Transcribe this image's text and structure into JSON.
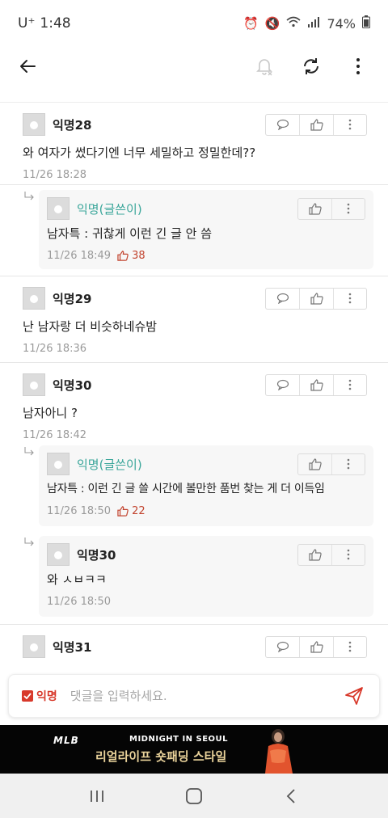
{
  "status": {
    "carrier": "U⁺",
    "time": "1:48",
    "battery": "74%"
  },
  "header": {
    "back_icon": "arrow-left-icon",
    "actions": [
      "bell-off-icon",
      "refresh-icon",
      "more-vertical-icon"
    ]
  },
  "comments": [
    {
      "author": "익명28",
      "body": "와 여자가 썼다기엔 너무 세밀하고 정밀한데??",
      "time": "11/26 18:28",
      "is_op": false,
      "reply": false
    },
    {
      "author": "익명(글쓴이)",
      "body": "남자특 : 귀찮게 이런 긴 글 안 씀",
      "time": "11/26 18:49",
      "likes": "38",
      "is_op": true,
      "reply": true
    },
    {
      "author": "익명29",
      "body": "난 남자랑 더 비슷하네슈밤",
      "time": "11/26 18:36",
      "is_op": false,
      "reply": false
    },
    {
      "author": "익명30",
      "body": "남자아니   ?",
      "time": "11/26 18:42",
      "is_op": false,
      "reply": false
    },
    {
      "author": "익명(글쓴이)",
      "body": "남자특 : 이런 긴 글 쓸 시간에 볼만한 품번 찾는 게 더 이득임",
      "time": "11/26 18:50",
      "likes": "22",
      "is_op": true,
      "reply": true
    },
    {
      "author": "익명30",
      "body": "와 ㅅㅂㅋㅋ",
      "time": "11/26 18:50",
      "is_op": false,
      "reply": true
    },
    {
      "author": "익명31",
      "body": "",
      "time": "",
      "is_op": false,
      "reply": false
    }
  ],
  "input": {
    "anon_label": "익명",
    "placeholder": "댓글을 입력하세요."
  },
  "ad": {
    "brand": "MLB",
    "title": "MIDNIGHT IN SEOUL",
    "subtitle": "리얼라이프 숏패딩 스타일"
  },
  "colors": {
    "accent": "#d8392b",
    "op_author": "#3aa69a",
    "like": "#c2442f"
  }
}
